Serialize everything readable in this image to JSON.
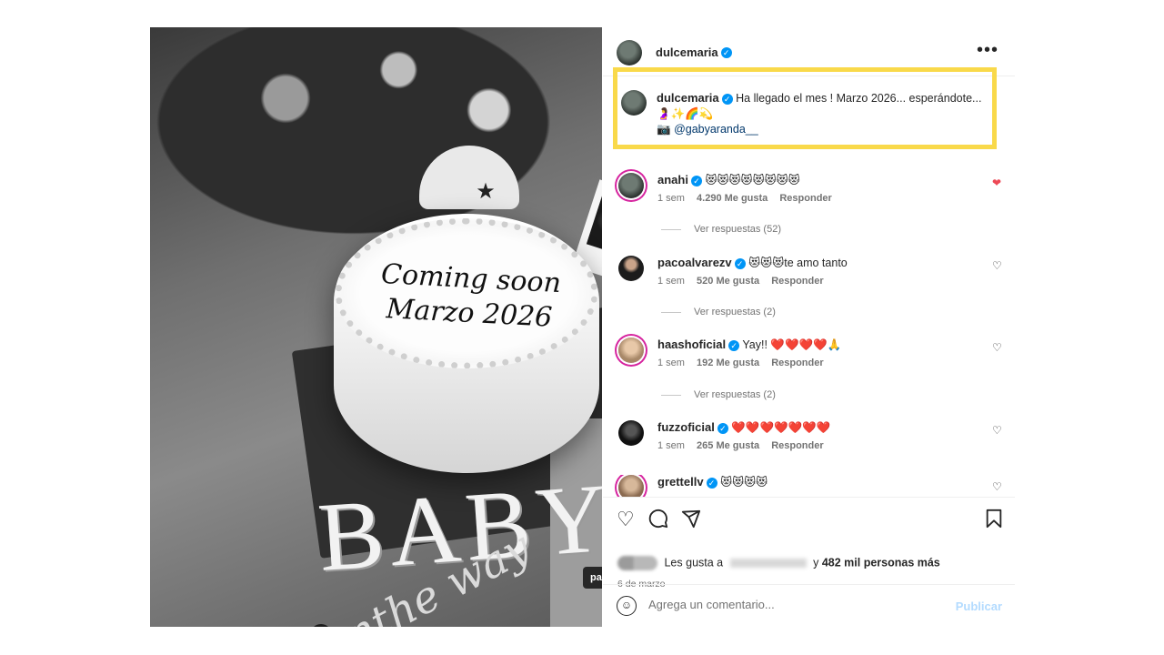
{
  "post": {
    "image": {
      "cake_line1": "Coming soon",
      "cake_line2": "Marzo 2026",
      "baby_text": "BABY",
      "on_the_way_text": "onthe way",
      "tag": "pacoalvarezv",
      "carousel_dots": 7,
      "carousel_active_index": 0
    },
    "author": {
      "username": "dulcemaria",
      "verified": true
    },
    "caption": {
      "username": "dulcemaria",
      "text": "Ha llegado el mes ! Marzo 2026... esperándote...",
      "emojis": "🤰✨🌈💫",
      "camera": "📷",
      "mention": "@gabyaranda__"
    },
    "comments": [
      {
        "username": "anahi",
        "verified": true,
        "text": "😻😻😻😻😻😻😻😻",
        "time": "1 sem",
        "likes": "4.290 Me gusta",
        "reply": "Responder",
        "replies": "Ver respuestas (52)",
        "liked": true
      },
      {
        "username": "pacoalvarezv",
        "verified": true,
        "text": "😻😻😻te amo tanto",
        "time": "1 sem",
        "likes": "520 Me gusta",
        "reply": "Responder",
        "replies": "Ver respuestas (2)",
        "liked": false
      },
      {
        "username": "haashoficial",
        "verified": true,
        "text": "Yay!! ❤️❤️❤️❤️🙏",
        "time": "1 sem",
        "likes": "192 Me gusta",
        "reply": "Responder",
        "replies": "Ver respuestas (2)",
        "liked": false
      },
      {
        "username": "fuzzoficial",
        "verified": true,
        "text": "❤️❤️❤️❤️❤️❤️❤️",
        "time": "1 sem",
        "likes": "265 Me gusta",
        "reply": "Responder",
        "liked": false
      },
      {
        "username": "grettellv",
        "verified": true,
        "text": "😻😻😻😻",
        "liked": false
      }
    ],
    "actions": {
      "like_icon": "heart-outline-icon",
      "comment_icon": "comment-icon",
      "share_icon": "send-icon",
      "save_icon": "bookmark-icon"
    },
    "likes_summary": {
      "prefix": "Les gusta a",
      "connector": "y",
      "count_text": "482 mil personas más"
    },
    "date": "6 de marzo",
    "comment_box": {
      "placeholder": "Agrega un comentario...",
      "publish_label": "Publicar"
    },
    "more_icon": "•••",
    "next_arrow": "›",
    "colors": {
      "highlight_border": "#f9d94a",
      "verified_blue": "#0095f6",
      "liked_red": "#ed4956",
      "publish_disabled": "#b3dbff"
    }
  }
}
